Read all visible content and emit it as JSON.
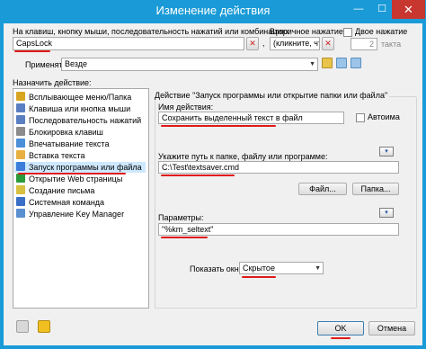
{
  "window": {
    "title": "Изменение действия",
    "minimize_glyph": "—",
    "maximize_glyph": "☐",
    "close_glyph": "✕"
  },
  "hotkey": {
    "label": "На клавиш, кнопку мыши, последовательность нажатий или комбинацию:",
    "value": "CapsLock",
    "clear_glyph": "✕",
    "comma": ",",
    "second_label": "Вторичное нажатие:",
    "second_value": "(кликните, что",
    "double_label": "Двое нажатие",
    "tact_value": "2",
    "tact_unit": "такта"
  },
  "apply": {
    "label": "Применять",
    "value": "Везде"
  },
  "assign": {
    "label": "Назначить действие:",
    "items": [
      {
        "label": "Всплывающее меню/Папка",
        "icon_color": "#d9a520",
        "icon": "folder-icon"
      },
      {
        "label": "Клавиша или кнопка мыши",
        "icon_color": "#5a7fc1",
        "icon": "keyboard-icon"
      },
      {
        "label": "Последовательность нажатий",
        "icon_color": "#5a7fc1",
        "icon": "keys-icon"
      },
      {
        "label": "Блокировка клавиш",
        "icon_color": "#8c8c8c",
        "icon": "lock-icon"
      },
      {
        "label": "Впечатывание текста",
        "icon_color": "#4a8fd8",
        "icon": "text-icon"
      },
      {
        "label": "Вставка текста",
        "icon_color": "#e8b040",
        "icon": "paste-icon"
      },
      {
        "label": "Запуск программы или файла",
        "icon_color": "#3b7dd8",
        "icon": "run-icon"
      },
      {
        "label": "Открытие Web страницы",
        "icon_color": "#2b9a3a",
        "icon": "web-icon"
      },
      {
        "label": "Создание письма",
        "icon_color": "#d8c040",
        "icon": "mail-icon"
      },
      {
        "label": "Системная команда",
        "icon_color": "#3a6fc8",
        "icon": "system-icon"
      },
      {
        "label": "Управление Key Manager",
        "icon_color": "#5a8fd0",
        "icon": "manager-icon"
      }
    ],
    "selected_index": 6
  },
  "action_group": {
    "title": "Действие \"Запуск программы или открытие папки или файла\"",
    "name_label": "Имя действия:",
    "name_value": "Сохранить выделенный текст в файл",
    "autorun_label": "Автоима",
    "path_label": "Укажите путь к папке, файлу или программе:",
    "path_value": "C:\\Test\\textsaver.cmd",
    "file_button": "Файл...",
    "folder_button": "Папка...",
    "params_label": "Параметры:",
    "params_value": "\"%km_seltext\"",
    "show_label": "Показать окно",
    "show_value": "Скрытое"
  },
  "footer": {
    "ok": "OK",
    "cancel": "Отмена"
  },
  "colors": {
    "title_bar": "#1a9bd7",
    "close_button": "#c7372f",
    "underline": "#e01a1a",
    "selection": "#cde8ff"
  }
}
